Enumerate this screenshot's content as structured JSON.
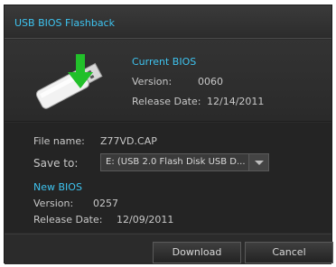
{
  "window": {
    "title": "USB BIOS Flashback"
  },
  "current_bios": {
    "heading": "Current BIOS",
    "version_label": "Version:",
    "version": "0060",
    "release_date_label": "Release Date:",
    "release_date": "12/14/2011"
  },
  "file": {
    "name_label": "File name:",
    "name": "Z77VD.CAP"
  },
  "save": {
    "label": "Save to:",
    "selected": "E: (USB 2.0 Flash Disk USB D..."
  },
  "new_bios": {
    "heading": "New BIOS",
    "version_label": "Version:",
    "version": "0257",
    "release_date_label": "Release Date:",
    "release_date": "12/09/2011"
  },
  "buttons": {
    "download": "Download",
    "cancel": "Cancel"
  },
  "colors": {
    "accent": "#3ec3ef",
    "background": "#2b2b2b",
    "arrow": "#22c02a"
  }
}
